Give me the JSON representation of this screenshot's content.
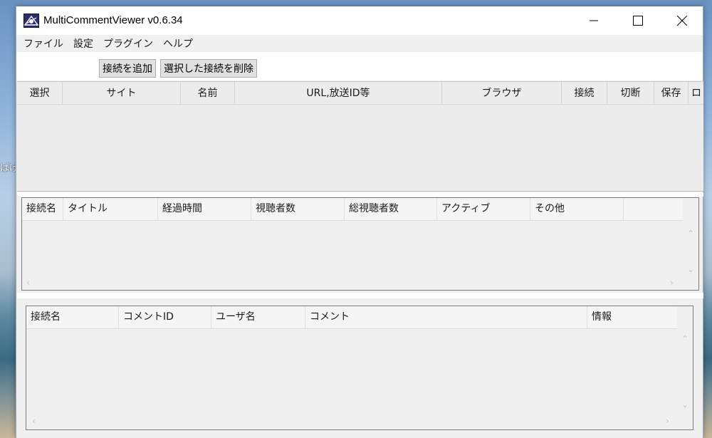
{
  "desktop": {
    "edge_text": "ばげ"
  },
  "window": {
    "title": "MultiCommentViewer v0.6.34",
    "minimize_glyph": "—",
    "maximize_glyph": "☐",
    "close_glyph": "✕"
  },
  "menu": {
    "items": [
      {
        "label": "ファイル"
      },
      {
        "label": "設定"
      },
      {
        "label": "プラグイン"
      },
      {
        "label": "ヘルプ"
      }
    ]
  },
  "toolbar": {
    "add_label": "接続を追加",
    "remove_label": "選択した接続を削除"
  },
  "connections_grid": {
    "columns": [
      "選択",
      "サイト",
      "名前",
      "URL,放送ID等",
      "ブラウザ",
      "接続",
      "切断",
      "保存",
      "ロ"
    ]
  },
  "meta_grid": {
    "columns": [
      "接続名",
      "タイトル",
      "経過時間",
      "視聴者数",
      "総視聴者数",
      "アクティブ",
      "その他",
      ""
    ]
  },
  "comment_grid": {
    "columns": [
      "接続名",
      "コメントID",
      "ユーザ名",
      "コメント",
      "情報"
    ]
  },
  "scroll": {
    "up": "⌃",
    "down": "⌄",
    "left": "‹",
    "right": "›"
  },
  "icons": {
    "app": "app-logo-icon",
    "up": "chevron-up-icon",
    "down": "chevron-down-icon",
    "left": "chevron-left-icon",
    "right": "chevron-right-icon"
  }
}
